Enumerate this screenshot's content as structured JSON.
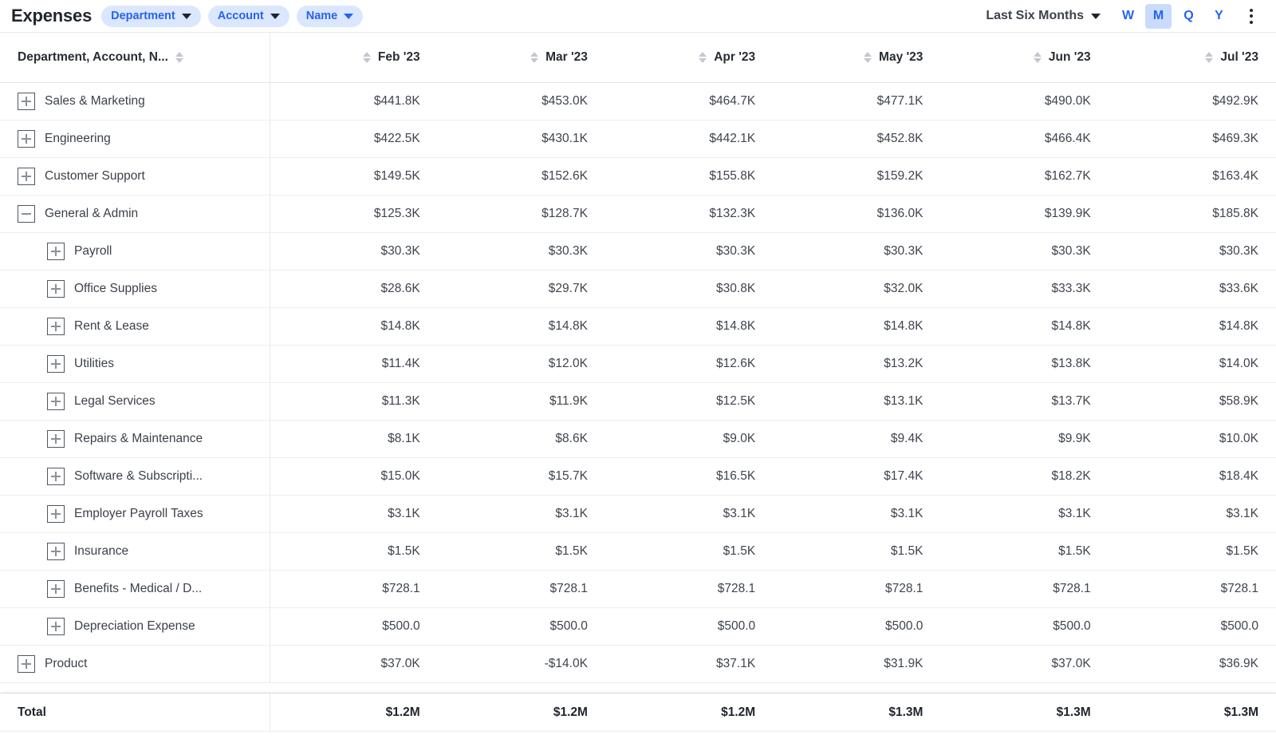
{
  "header": {
    "title": "Expenses",
    "filter_pills": [
      {
        "label": "Department",
        "icon": "chevron-down-icon"
      },
      {
        "label": "Account",
        "icon": "chevron-down-icon"
      },
      {
        "label": "Name",
        "icon": "chevron-down-icon"
      }
    ],
    "range": {
      "label": "Last Six Months",
      "icon": "chevron-down-icon"
    },
    "granularity": [
      {
        "label": "W",
        "active": false
      },
      {
        "label": "M",
        "active": true
      },
      {
        "label": "Q",
        "active": false
      },
      {
        "label": "Y",
        "active": false
      }
    ],
    "overflow_menu": {
      "icon": "kebab-menu-icon"
    },
    "accent_color": "#2563f0",
    "pill_bg_color": "#dbe7fe",
    "active_bg_color": "#c9dcfd"
  },
  "table": {
    "columns": [
      {
        "label": "Department, Account, N...",
        "sortable": true
      },
      {
        "label": "Feb '23",
        "sortable": true
      },
      {
        "label": "Mar '23",
        "sortable": true
      },
      {
        "label": "Apr '23",
        "sortable": true
      },
      {
        "label": "May '23",
        "sortable": true
      },
      {
        "label": "Jun '23",
        "sortable": true
      },
      {
        "label": "Jul '23",
        "sortable": true
      }
    ],
    "rows": [
      {
        "label": "Sales & Marketing",
        "level": 0,
        "state": "collapsed",
        "values": [
          "$441.8K",
          "$453.0K",
          "$464.7K",
          "$477.1K",
          "$490.0K",
          "$492.9K"
        ]
      },
      {
        "label": "Engineering",
        "level": 0,
        "state": "collapsed",
        "values": [
          "$422.5K",
          "$430.1K",
          "$442.1K",
          "$452.8K",
          "$466.4K",
          "$469.3K"
        ]
      },
      {
        "label": "Customer Support",
        "level": 0,
        "state": "collapsed",
        "values": [
          "$149.5K",
          "$152.6K",
          "$155.8K",
          "$159.2K",
          "$162.7K",
          "$163.4K"
        ]
      },
      {
        "label": "General & Admin",
        "level": 0,
        "state": "expanded",
        "values": [
          "$125.3K",
          "$128.7K",
          "$132.3K",
          "$136.0K",
          "$139.9K",
          "$185.8K"
        ]
      },
      {
        "label": "Payroll",
        "level": 1,
        "state": "collapsed",
        "values": [
          "$30.3K",
          "$30.3K",
          "$30.3K",
          "$30.3K",
          "$30.3K",
          "$30.3K"
        ]
      },
      {
        "label": "Office Supplies",
        "level": 1,
        "state": "collapsed",
        "values": [
          "$28.6K",
          "$29.7K",
          "$30.8K",
          "$32.0K",
          "$33.3K",
          "$33.6K"
        ]
      },
      {
        "label": "Rent & Lease",
        "level": 1,
        "state": "collapsed",
        "values": [
          "$14.8K",
          "$14.8K",
          "$14.8K",
          "$14.8K",
          "$14.8K",
          "$14.8K"
        ]
      },
      {
        "label": "Utilities",
        "level": 1,
        "state": "collapsed",
        "values": [
          "$11.4K",
          "$12.0K",
          "$12.6K",
          "$13.2K",
          "$13.8K",
          "$14.0K"
        ]
      },
      {
        "label": "Legal Services",
        "level": 1,
        "state": "collapsed",
        "values": [
          "$11.3K",
          "$11.9K",
          "$12.5K",
          "$13.1K",
          "$13.7K",
          "$58.9K"
        ]
      },
      {
        "label": "Repairs & Maintenance",
        "level": 1,
        "state": "collapsed",
        "values": [
          "$8.1K",
          "$8.6K",
          "$9.0K",
          "$9.4K",
          "$9.9K",
          "$10.0K"
        ]
      },
      {
        "label": "Software & Subscripti...",
        "level": 1,
        "state": "collapsed",
        "values": [
          "$15.0K",
          "$15.7K",
          "$16.5K",
          "$17.4K",
          "$18.2K",
          "$18.4K"
        ]
      },
      {
        "label": "Employer Payroll Taxes",
        "level": 1,
        "state": "collapsed",
        "values": [
          "$3.1K",
          "$3.1K",
          "$3.1K",
          "$3.1K",
          "$3.1K",
          "$3.1K"
        ]
      },
      {
        "label": "Insurance",
        "level": 1,
        "state": "collapsed",
        "values": [
          "$1.5K",
          "$1.5K",
          "$1.5K",
          "$1.5K",
          "$1.5K",
          "$1.5K"
        ]
      },
      {
        "label": "Benefits - Medical / D...",
        "level": 1,
        "state": "collapsed",
        "values": [
          "$728.1",
          "$728.1",
          "$728.1",
          "$728.1",
          "$728.1",
          "$728.1"
        ]
      },
      {
        "label": "Depreciation Expense",
        "level": 1,
        "state": "collapsed",
        "values": [
          "$500.0",
          "$500.0",
          "$500.0",
          "$500.0",
          "$500.0",
          "$500.0"
        ]
      },
      {
        "label": "Product",
        "level": 0,
        "state": "collapsed",
        "values": [
          "$37.0K",
          "-$14.0K",
          "$37.1K",
          "$31.9K",
          "$37.0K",
          "$36.9K"
        ]
      }
    ],
    "total": {
      "label": "Total",
      "values": [
        "$1.2M",
        "$1.2M",
        "$1.2M",
        "$1.3M",
        "$1.3M",
        "$1.3M"
      ]
    }
  }
}
